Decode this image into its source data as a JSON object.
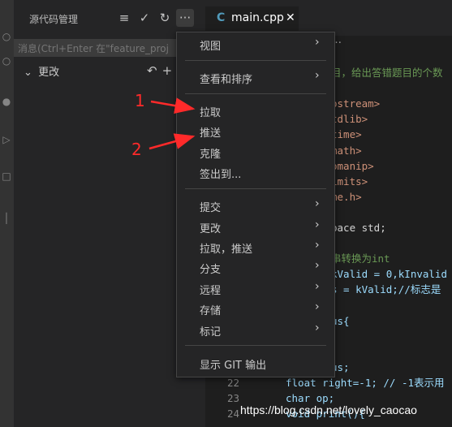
{
  "sidebar": {
    "title": "源代码管理",
    "actions": [
      "≡",
      "✓",
      "↻",
      "···"
    ],
    "message_placeholder": "消息(Ctrl+Enter 在\"feature_proj",
    "changes_label": "更改",
    "changes_actions": [
      "↶",
      "+"
    ]
  },
  "editor": {
    "tab_icon": "C",
    "tab_name": "main.cpp",
    "tab_close": "✕",
    "breadcrumb": "…",
    "lines": [
      {
        "n": "",
        "t": "目，给出答错题目的个数",
        "c": "cm"
      },
      {
        "n": "",
        "t": "",
        "c": "def"
      },
      {
        "n": "",
        "t": "ostream>",
        "c": "str"
      },
      {
        "n": "",
        "t": "tdlib>",
        "c": "str"
      },
      {
        "n": "",
        "t": "time>",
        "c": "str"
      },
      {
        "n": "",
        "t": "math>",
        "c": "str"
      },
      {
        "n": "",
        "t": "omanip>",
        "c": "str"
      },
      {
        "n": "",
        "t": "imits>",
        "c": "str"
      },
      {
        "n": "",
        "t": "me.h>",
        "c": "str"
      },
      {
        "n": "",
        "t": "",
        "c": "def"
      },
      {
        "n": "",
        "t": "pace std;",
        "c": "def"
      },
      {
        "n": "",
        "t": "",
        "c": "def"
      },
      {
        "n": "",
        "t": "串转换为int",
        "c": "cm"
      },
      {
        "n": "",
        "t": "kValid = 0,kInvalid",
        "c": "var"
      },
      {
        "n": "",
        "t": "s = kValid;//标志是",
        "c": "var"
      },
      {
        "n": "",
        "t": "",
        "c": "def"
      },
      {
        "n": "",
        "t": "us{",
        "c": "var"
      },
      {
        "n": "",
        "t": "",
        "c": "def"
      },
      {
        "n": "",
        "t": "",
        "c": "def"
      },
      {
        "n": "",
        "t": "us;",
        "c": "var"
      },
      {
        "n": "22",
        "t": "float right=-1; // -1表示用",
        "c": "mix1"
      },
      {
        "n": "23",
        "t": "char op;",
        "c": "mix2"
      },
      {
        "n": "24",
        "t": "void print(){",
        "c": "mix3"
      }
    ]
  },
  "menu": {
    "items": [
      {
        "label": "视图",
        "sub": true
      },
      {
        "label": "查看和排序",
        "sub": true
      },
      {
        "label": "拉取",
        "sub": false
      },
      {
        "label": "推送",
        "sub": false
      },
      {
        "label": "克隆",
        "sub": false
      },
      {
        "label": "签出到...",
        "sub": false
      },
      {
        "label": "提交",
        "sub": true
      },
      {
        "label": "更改",
        "sub": true
      },
      {
        "label": "拉取，推送",
        "sub": true
      },
      {
        "label": "分支",
        "sub": true
      },
      {
        "label": "远程",
        "sub": true
      },
      {
        "label": "存储",
        "sub": true
      },
      {
        "label": "标记",
        "sub": true
      },
      {
        "label": "显示 GIT 输出",
        "sub": false
      }
    ],
    "arrow_glyph": "›"
  },
  "annotations": {
    "one": "1",
    "two": "2",
    "color": "#ff2a2a"
  },
  "watermark": "https://blog.csdn.net/lovely_caocao",
  "colors": {
    "bg": "#1e1e1e",
    "sidebar": "#252526",
    "menu": "#252526",
    "keyword": "#569cd6",
    "string": "#ce9178",
    "comment": "#6a9955"
  }
}
